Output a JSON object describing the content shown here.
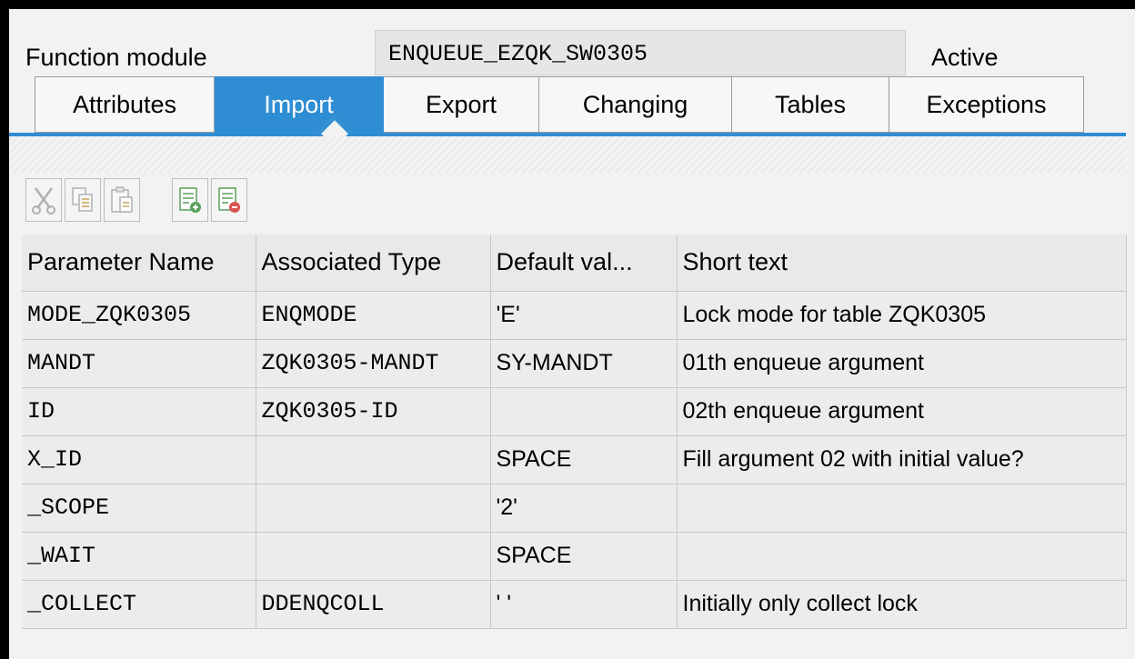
{
  "header": {
    "label": "Function module",
    "value": "ENQUEUE_EZQK_SW0305",
    "status": "Active"
  },
  "tabs": [
    {
      "label": "Attributes",
      "active": false
    },
    {
      "label": "Import",
      "active": true
    },
    {
      "label": "Export",
      "active": false
    },
    {
      "label": "Changing",
      "active": false
    },
    {
      "label": "Tables",
      "active": false
    },
    {
      "label": "Exceptions",
      "active": false
    }
  ],
  "toolbar": {
    "icons": [
      "cut-icon",
      "copy-icon",
      "paste-icon",
      "insert-row-icon",
      "delete-row-icon"
    ]
  },
  "table": {
    "columns": [
      "Parameter Name",
      "Associated Type",
      "Default val...",
      "Short text"
    ],
    "rows": [
      [
        "MODE_ZQK0305",
        "ENQMODE",
        "'E'",
        "Lock mode for table ZQK0305"
      ],
      [
        "MANDT",
        "ZQK0305-MANDT",
        "SY-MANDT",
        "01th enqueue argument"
      ],
      [
        "ID",
        "ZQK0305-ID",
        "",
        "02th enqueue argument"
      ],
      [
        "X_ID",
        "",
        "SPACE",
        "Fill argument 02 with initial value?"
      ],
      [
        "_SCOPE",
        "",
        "'2'",
        ""
      ],
      [
        "_WAIT",
        "",
        "SPACE",
        ""
      ],
      [
        "_COLLECT",
        "DDENQCOLL",
        "' '",
        "Initially only collect lock"
      ]
    ]
  },
  "colors": {
    "accent": "#2f8dd3",
    "background": "#f2f2f2"
  }
}
